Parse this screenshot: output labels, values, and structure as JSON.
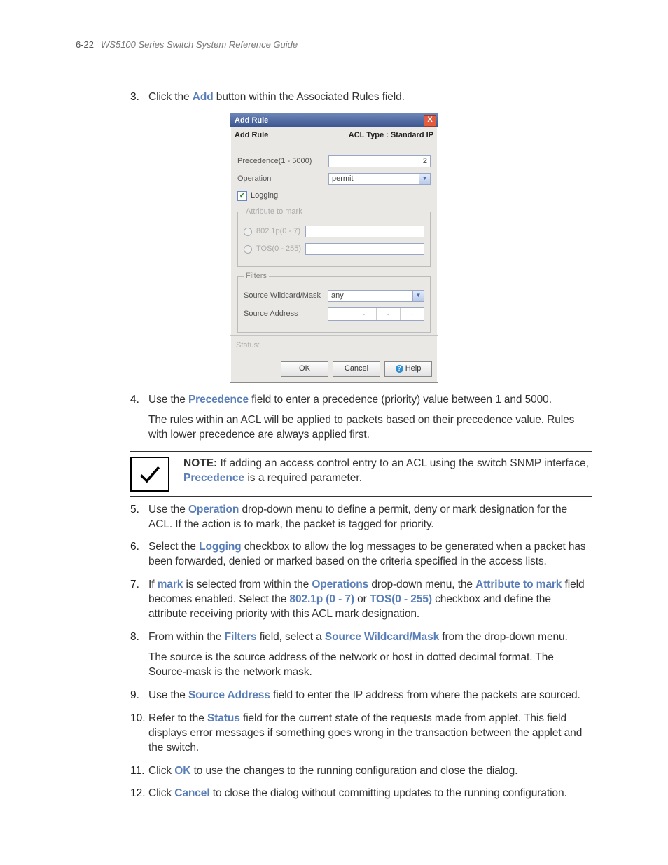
{
  "header": {
    "page_num": "6-22",
    "title": "WS5100 Series Switch System Reference Guide"
  },
  "steps": {
    "s3": {
      "n": "3.",
      "pre": "Click the ",
      "hl": "Add",
      "post": " button within the Associated Rules field."
    },
    "s4": {
      "n": "4.",
      "pre": "Use the ",
      "hl": "Precedence",
      "post": " field to enter a precedence (priority) value between 1 and 5000.",
      "extra": "The rules within an ACL will be applied to packets based on their precedence value. Rules with lower precedence are always applied first."
    },
    "s5": {
      "n": "5.",
      "pre": "Use the ",
      "hl": "Operation",
      "post": " drop-down menu to define a permit, deny or mark designation for the ACL. If the action is to mark, the packet is tagged for priority."
    },
    "s6": {
      "n": "6.",
      "pre": "Select the ",
      "hl": "Logging",
      "post": " checkbox to allow the log messages to be generated when a packet has been forwarded, denied or marked based on the criteria specified in the access lists."
    },
    "s7": {
      "n": "7.",
      "t1": "If ",
      "hl1": "mark",
      "t2": " is selected from within the ",
      "hl2": "Operations",
      "t3": " drop-down menu, the ",
      "hl3": "Attribute to mark",
      "t4": " field becomes enabled. Select the ",
      "hl4": "802.1p (0 - 7)",
      "t5": " or ",
      "hl5": "TOS(0 - 255)",
      "t6": " checkbox and define the attribute receiving priority with this ACL mark designation."
    },
    "s8": {
      "n": "8.",
      "t1": "From within the ",
      "hl1": "Filters",
      "t2": " field, select a ",
      "hl2": "Source Wildcard/Mask",
      "t3": " from the drop-down menu.",
      "extra": "The source is the source address of the network or host in dotted decimal format. The Source-mask is the network mask."
    },
    "s9": {
      "n": "9.",
      "pre": "Use the ",
      "hl": "Source Address",
      "post": " field to enter the IP address from where the packets are sourced."
    },
    "s10": {
      "n": "10.",
      "pre": "Refer to the ",
      "hl": "Status",
      "post": " field for the current state of the requests made from applet. This field displays error messages if something goes wrong in the transaction between the applet and the switch."
    },
    "s11": {
      "n": "11.",
      "pre": "Click ",
      "hl": "OK",
      "post": " to use the changes to the running configuration and close the dialog."
    },
    "s12": {
      "n": "12.",
      "pre": "Click ",
      "hl": "Cancel",
      "post": " to close the dialog without committing updates to the running configuration."
    }
  },
  "note": {
    "label": "NOTE:",
    "t1": " If adding an access control entry to an ACL using the switch SNMP interface, ",
    "hl": "Precedence",
    "t2": " is a required parameter."
  },
  "dialog": {
    "title": "Add Rule",
    "sub_left": "Add Rule",
    "sub_right": "ACL Type : Standard IP",
    "precedence_label": "Precedence(1 - 5000)",
    "precedence_value": "2",
    "operation_label": "Operation",
    "operation_value": "permit",
    "logging_label": "Logging",
    "attr_legend": "Attribute to mark",
    "attr_8021p": "802.1p(0 - 7)",
    "attr_tos": "TOS(0 - 255)",
    "filters_legend": "Filters",
    "swm_label": "Source Wildcard/Mask",
    "swm_value": "any",
    "src_addr_label": "Source Address",
    "status_label": "Status:",
    "ok": "OK",
    "cancel": "Cancel",
    "help": "Help"
  }
}
